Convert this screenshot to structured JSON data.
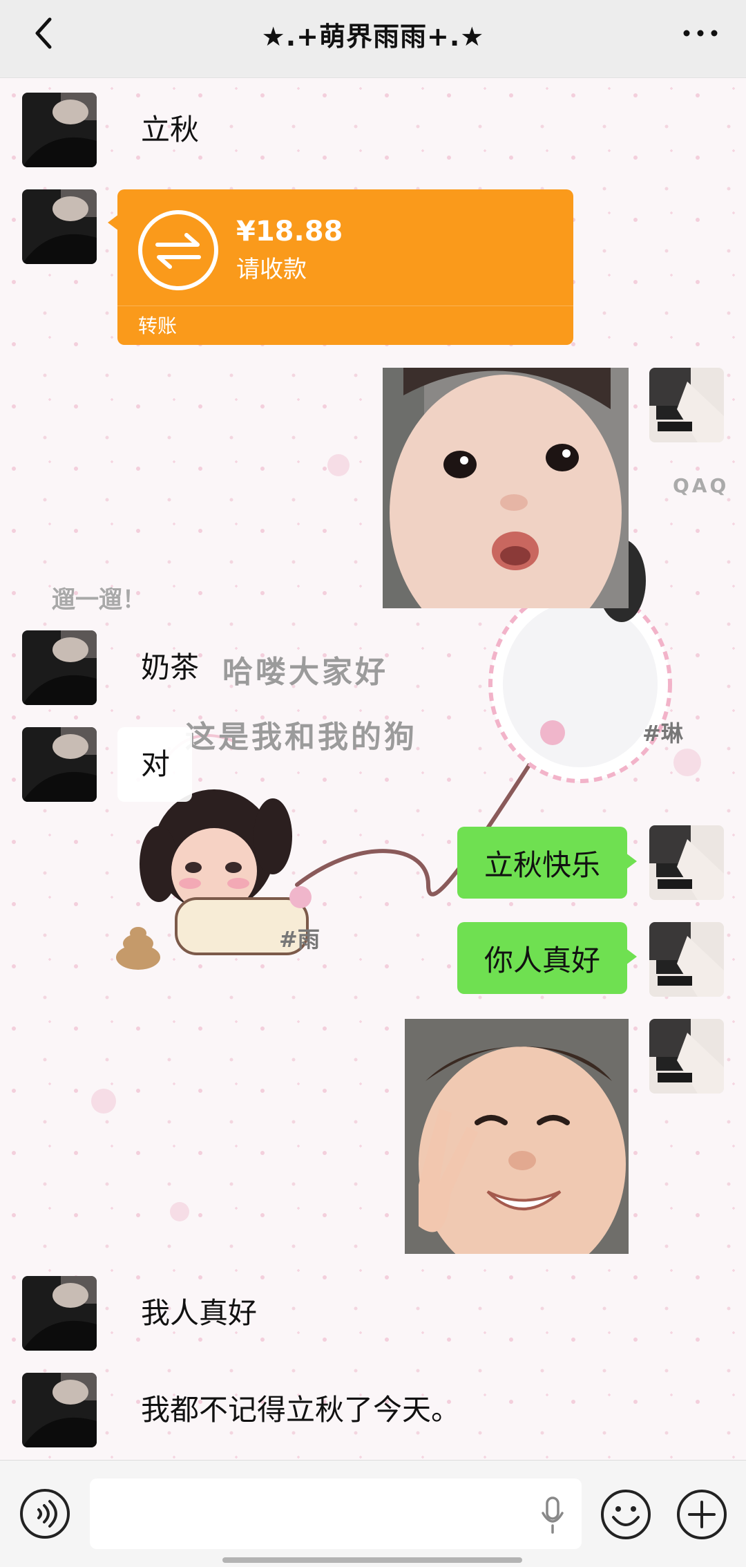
{
  "header": {
    "title": "★.+萌界雨雨+.★"
  },
  "messages": {
    "m1": "立秋",
    "transfer": {
      "amount": "¥18.88",
      "status": "请收款",
      "label": "转账"
    },
    "m3": "奶茶",
    "m4": "对",
    "m5": "立秋快乐",
    "m6": "你人真好",
    "m7": "我人真好",
    "m8": "我都不记得立秋了今天。"
  },
  "background_stickers": {
    "caption1": "遛一遛！",
    "caption2": "哈喽大家好",
    "caption3": "这是我和我的狗",
    "tag1": "#琳",
    "tag2": "#雨",
    "tag3": "QAQ"
  },
  "colors": {
    "header_bg": "#ededed",
    "transfer": "#fa9a1b",
    "green_bubble": "#6fe051",
    "toolbar_bg": "#f5f5f5"
  },
  "icons": [
    "back-icon",
    "more-icon",
    "transfer-icon",
    "voice-icon",
    "mic-icon",
    "emoji-icon",
    "plus-icon"
  ]
}
